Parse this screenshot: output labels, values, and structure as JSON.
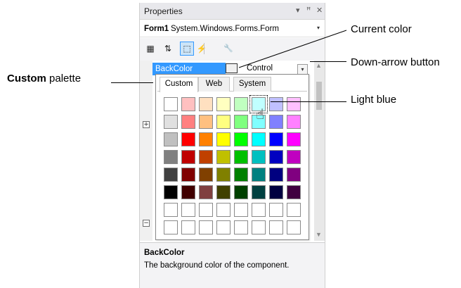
{
  "panel": {
    "title": "Properties",
    "title_icons": {
      "dropdown": "▾",
      "pin": "ꟸ",
      "close": "✕"
    },
    "object_name": "Form1",
    "object_type": "System.Windows.Forms.Form",
    "object_dropdown": "▾",
    "toolbar": [
      {
        "icon": "categorized-icon",
        "glyph": "▦",
        "active": false
      },
      {
        "icon": "alphabetical-icon",
        "glyph": "⇅",
        "active": false
      },
      {
        "icon": "properties-icon",
        "glyph": "⬚",
        "active": true
      },
      {
        "icon": "events-icon",
        "glyph": "⚡",
        "active": false
      },
      {
        "icon": "property-pages-icon",
        "glyph": "🔧",
        "active": false
      }
    ],
    "expanders": [
      {
        "glyph": "+"
      },
      {
        "glyph": "−"
      }
    ],
    "property": {
      "name": "BackColor",
      "value": "Control",
      "dropdown_glyph": "▾"
    },
    "description": {
      "title": "BackColor",
      "text": "The background color of the component."
    }
  },
  "popup": {
    "tabs": [
      {
        "label": "Custom",
        "active": true
      },
      {
        "label": "Web",
        "active": false
      },
      {
        "label": "System",
        "active": false
      }
    ],
    "palette": [
      [
        "#ffffff",
        "#ffc0c0",
        "#ffe0c0",
        "#ffffc0",
        "#c0ffc0",
        "#c0ffff",
        "#c0c0ff",
        "#ffc0ff"
      ],
      [
        "#e0e0e0",
        "#ff8080",
        "#ffc080",
        "#ffff80",
        "#80ff80",
        "#80ffff",
        "#8080ff",
        "#ff80ff"
      ],
      [
        "#c0c0c0",
        "#ff0000",
        "#ff8000",
        "#ffff00",
        "#00ff00",
        "#00ffff",
        "#0000ff",
        "#ff00ff"
      ],
      [
        "#808080",
        "#c00000",
        "#c04000",
        "#c0c000",
        "#00c000",
        "#00c0c0",
        "#0000c0",
        "#c000c0"
      ],
      [
        "#404040",
        "#800000",
        "#804000",
        "#808000",
        "#008000",
        "#008080",
        "#000080",
        "#800080"
      ],
      [
        "#000000",
        "#400000",
        "#804040",
        "#404000",
        "#004000",
        "#004040",
        "#000040",
        "#400040"
      ],
      [
        "#ffffff",
        "#ffffff",
        "#ffffff",
        "#ffffff",
        "#ffffff",
        "#ffffff",
        "#ffffff",
        "#ffffff"
      ],
      [
        "#ffffff",
        "#ffffff",
        "#ffffff",
        "#ffffff",
        "#ffffff",
        "#ffffff",
        "#ffffff",
        "#ffffff"
      ]
    ],
    "selected": {
      "row": 0,
      "col": 5
    }
  },
  "callouts": {
    "custom_palette_bold": "Custom",
    "custom_palette_rest": " palette",
    "current_color": "Current color",
    "down_arrow_button": "Down-arrow button",
    "light_blue": "Light blue"
  }
}
